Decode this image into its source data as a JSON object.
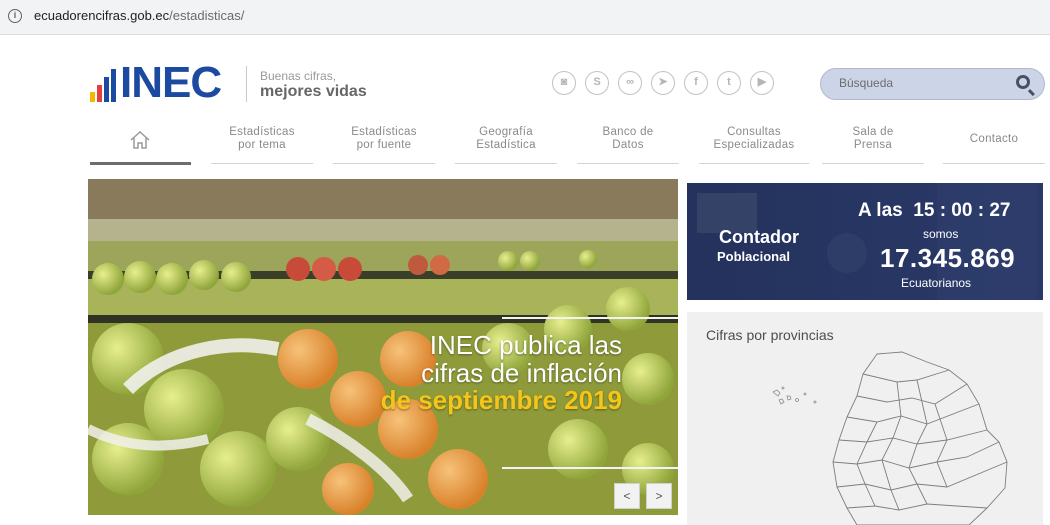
{
  "browser": {
    "url_domain": "ecuadorencifras.gob.ec",
    "url_path": "/estadisticas/",
    "info_icon": "info-icon"
  },
  "header": {
    "logo_text": "INEC",
    "logo_bar_colors": [
      "#f5b800",
      "#e63f3f",
      "#1b4aa0",
      "#1b4aa0"
    ],
    "tagline_line1": "Buenas cifras,",
    "tagline_line2": "mejores vidas",
    "social_icons": [
      "instagram-icon",
      "skype-icon",
      "flickr-icon",
      "telegram-icon",
      "facebook-icon",
      "twitter-icon",
      "youtube-icon"
    ],
    "search_placeholder": "Búsqueda"
  },
  "nav": {
    "home_icon": "house-icon",
    "items": [
      {
        "line1": "Estadísticas",
        "line2": "por tema"
      },
      {
        "line1": "Estadísticas",
        "line2": "por fuente"
      },
      {
        "line1": "Geografía",
        "line2": "Estadística"
      },
      {
        "line1": "Banco de",
        "line2": "Datos"
      },
      {
        "line1": "Consultas",
        "line2": "Especializadas"
      },
      {
        "line1": "Sala de",
        "line2": "Prensa"
      },
      {
        "line1": "Contacto",
        "line2": ""
      }
    ]
  },
  "hero": {
    "line1": "INEC publica las",
    "line2": "cifras de inflación",
    "line3": "de septiembre 2019",
    "highlight_color": "#f5c518",
    "prev_label": "<",
    "next_label": ">"
  },
  "counter": {
    "title1": "Contador",
    "title2": "Poblacional",
    "time_prefix": "A las",
    "time": "15 : 00 : 27",
    "somos": "somos",
    "population": "17.345.869",
    "suffix": "Ecuatorianos"
  },
  "provinces": {
    "title": "Cifras por provincias"
  },
  "colors": {
    "brand_blue": "#1b4aa0",
    "counter_bg": "#2d3c6e",
    "search_bg": "#ccd4e8"
  }
}
